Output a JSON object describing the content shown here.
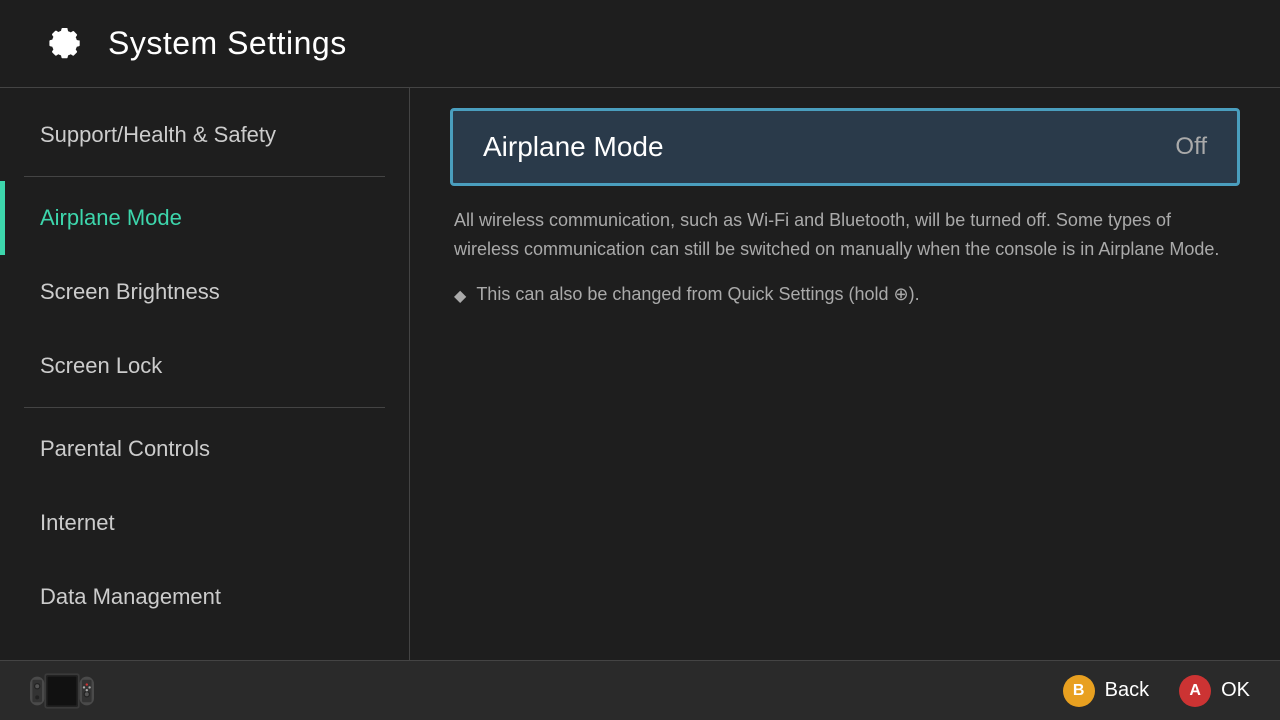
{
  "header": {
    "title": "System Settings",
    "icon": "gear"
  },
  "sidebar": {
    "items": [
      {
        "id": "support-health-safety",
        "label": "Support/Health & Safety",
        "active": false,
        "divider_after": true
      },
      {
        "id": "airplane-mode",
        "label": "Airplane Mode",
        "active": true,
        "divider_after": false
      },
      {
        "id": "screen-brightness",
        "label": "Screen Brightness",
        "active": false,
        "divider_after": false
      },
      {
        "id": "screen-lock",
        "label": "Screen Lock",
        "active": false,
        "divider_after": true
      },
      {
        "id": "parental-controls",
        "label": "Parental Controls",
        "active": false,
        "divider_after": false
      },
      {
        "id": "internet",
        "label": "Internet",
        "active": false,
        "divider_after": false
      },
      {
        "id": "data-management",
        "label": "Data Management",
        "active": false,
        "divider_after": false
      }
    ]
  },
  "content": {
    "selected_title": "Airplane Mode",
    "selected_value": "Off",
    "description": "All wireless communication, such as Wi-Fi and Bluetooth, will be turned off. Some types of wireless communication can still be switched on manually when the console is in Airplane Mode.",
    "note": "This can also be changed from Quick Settings (hold ⊕)."
  },
  "bottom_bar": {
    "back_label": "Back",
    "ok_label": "OK",
    "back_btn": "B",
    "ok_btn": "A"
  }
}
